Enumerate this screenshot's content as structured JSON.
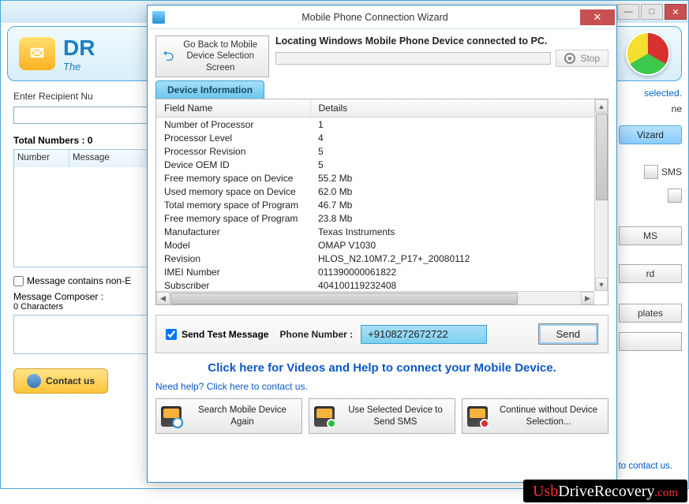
{
  "bg": {
    "logo_text": "DR",
    "logo_sub": "The",
    "recipient_label": "Enter Recipient Nu",
    "total_label": "Total Numbers : 0",
    "grid_headers": [
      "Number",
      "Message"
    ],
    "nonlatin_checkbox": "Message contains non-E",
    "composer_label": "Message Composer :",
    "composer_sub": "0 Characters",
    "contact_btn": "Contact us",
    "right": {
      "selected": "selected.",
      "ne": "ne",
      "wizard": "Vizard",
      "sms": "SMS",
      "ms": "MS",
      "rd": "rd",
      "plates": "plates"
    },
    "need_help_bottom": "Need help? Click here to contact us."
  },
  "wizard": {
    "title": "Mobile Phone Connection Wizard",
    "go_back": "Go Back to Mobile Device Selection Screen",
    "locating": "Locating Windows Mobile Phone Device connected to PC.",
    "stop": "Stop",
    "tab": "Device Information",
    "table": {
      "headers": [
        "Field Name",
        "Details"
      ],
      "rows": [
        [
          "Number of Processor",
          "1"
        ],
        [
          "Processor Level",
          "4"
        ],
        [
          "Processor Revision",
          "5"
        ],
        [
          "Device OEM ID",
          "5"
        ],
        [
          "Free memory space on Device",
          "55.2 Mb"
        ],
        [
          "Used memory space on Device",
          "62.0 Mb"
        ],
        [
          "Total memory space of Program",
          "46.7 Mb"
        ],
        [
          "Free memory space of Program",
          "23.8 Mb"
        ],
        [
          "Manufacturer",
          "Texas Instruments"
        ],
        [
          "Model",
          "OMAP V1030"
        ],
        [
          "Revision",
          "HLOS_N2.10M7.2_P17+_20080112"
        ],
        [
          "IMEI Number",
          "011390000061822"
        ],
        [
          "Subscriber",
          "404100119232408"
        ]
      ]
    },
    "send_test_chk": "Send Test Message",
    "phone_label": "Phone Number :",
    "phone_value": "+9108272672722",
    "send_btn": "Send",
    "help_link": "Click here for Videos and Help to connect your Mobile Device.",
    "need_help": "Need help? Click here to contact us.",
    "buttons": {
      "search_again": "Search Mobile Device Again",
      "use_selected": "Use Selected Device to Send SMS",
      "continue_without": "Continue without Device Selection..."
    }
  },
  "url": {
    "p1": "Usb",
    "p2": "DriveRecovery",
    "p3": ".com"
  },
  "chart_data": {
    "type": "pie",
    "title": "",
    "categories": [
      "Red",
      "Green",
      "Yellow"
    ],
    "values": [
      33,
      33,
      33
    ]
  }
}
